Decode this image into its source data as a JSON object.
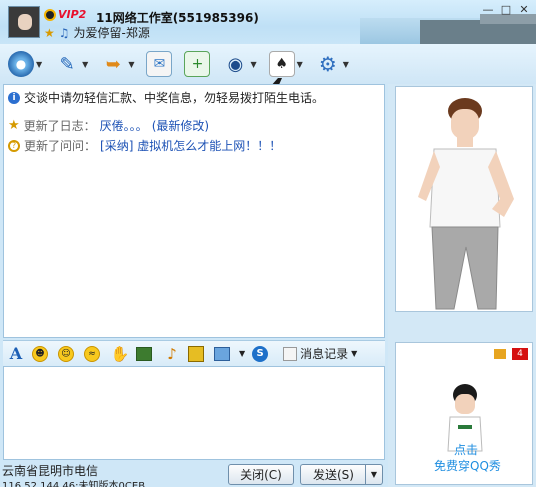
{
  "header": {
    "vip_label": "VIP2",
    "contact_name": "11网络工作室(551985396)",
    "signature": "为爱停留-郑源"
  },
  "toolbar": {
    "icons": [
      "webcam-icon",
      "microphone-icon",
      "send-file-icon",
      "email-icon",
      "note-icon",
      "remote-assist-icon",
      "games-icon",
      "settings-icon"
    ]
  },
  "chat": {
    "warning": "交谈中请勿轻信汇款、中奖信息，勿轻易拨打陌生电话。",
    "blog_prefix": "更新了日志：",
    "blog_title": "厌倦。。。",
    "blog_suffix": "(最新修改)",
    "question_prefix": "更新了问问：",
    "question_title": "[采纳] 虚拟机怎么才能上网！！！"
  },
  "format_bar": {
    "history_label": "消息记录"
  },
  "footer": {
    "location": "云南省昆明市电信",
    "ip_info": "116.52.144.46:未知版本0CEB",
    "close_label": "关闭(C)",
    "send_label": "发送(S)"
  },
  "sidebar": {
    "badge_count": "4",
    "promo_line1": "点击",
    "promo_line2": "免费穿QQ秀"
  },
  "colors": {
    "accent": "#1d52b5",
    "vip": "#e8102e",
    "badge": "#d51010",
    "promo": "#1f8ee0"
  }
}
